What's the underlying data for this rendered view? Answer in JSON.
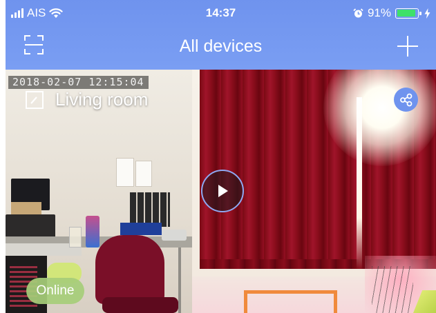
{
  "status_bar": {
    "carrier": "AIS",
    "time": "14:37",
    "battery_percent": "91%",
    "battery_level": 0.91,
    "icons": [
      "signal-bars-icon",
      "wifi-icon",
      "alarm-icon",
      "battery-icon",
      "charging-bolt-icon"
    ]
  },
  "nav": {
    "title": "All devices",
    "left_icon": "scan-icon",
    "right_icon": "plus-icon"
  },
  "device": {
    "timestamp": "2018-02-07  12:15:04",
    "name": "Living room",
    "status": "Online",
    "edit_icon": "edit-icon",
    "share_icon": "share-icon",
    "play_icon": "play-icon"
  },
  "colors": {
    "header_blue": "#7a9ef3",
    "share_button": "#6f93ee",
    "online_badge": "#a6cd78",
    "highlight_orange": "#f08a3c",
    "battery_green": "#3ee06a"
  }
}
